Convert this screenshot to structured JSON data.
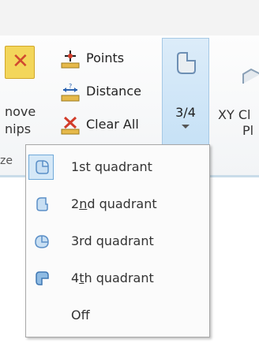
{
  "ribbon": {
    "remove_button": {
      "label_line1": "nove",
      "label_line2": "nips"
    },
    "points_button": {
      "label": "Points"
    },
    "distance_button": {
      "label": "Distance"
    },
    "clear_all_button": {
      "label": "Clear All"
    },
    "group_label_fragment": "ze",
    "quadrant_button": {
      "label": "3/4"
    },
    "xy_button": {
      "label_line1": "XY Cl",
      "label_line2": "Pl"
    }
  },
  "menu": {
    "items": [
      {
        "pre": "1st quadrant",
        "underline": "",
        "post": "",
        "icon": "quadrant-1-icon"
      },
      {
        "pre": "2",
        "underline": "n",
        "post": "d quadrant",
        "icon": "quadrant-2-icon"
      },
      {
        "pre": "3rd quadrant",
        "underline": "",
        "post": "",
        "icon": "quadrant-3-icon"
      },
      {
        "pre": "4",
        "underline": "t",
        "post": "h quadrant",
        "icon": "quadrant-4-icon"
      },
      {
        "pre": "Off",
        "underline": "",
        "post": "",
        "icon": ""
      }
    ],
    "selected_index": 0
  },
  "colors": {
    "accent": "#c6e1f6",
    "accent_border": "#6fa9d9",
    "icon_blue": "#5b8fc7"
  }
}
